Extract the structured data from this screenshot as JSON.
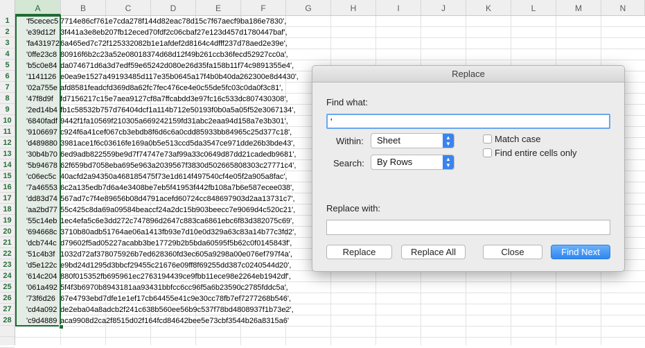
{
  "columns": [
    "A",
    "B",
    "C",
    "D",
    "E",
    "F",
    "G",
    "H",
    "I",
    "J",
    "K",
    "L",
    "M",
    "N"
  ],
  "rows": [
    {
      "n": "1",
      "a": "'f5cecec5",
      "rest": "7714e86cf761e7cda278f144d82eac78d15c7f67aecf9ba186e7830',"
    },
    {
      "n": "2",
      "a": "'e39d12f",
      "rest": "3f441a3e8eb207fb12eced70fdf2c06cbaf27e123d457d1780447baf',"
    },
    {
      "n": "3",
      "a": "'fa431972",
      "rest": "6a465ed7c72f125332082b1e1afdef2d8164c4dfff237d78aed2e39e',"
    },
    {
      "n": "4",
      "a": "'0ffe23c8",
      "rest": "80916f6b2c23a52e08018374d68d12f49b261ccb36fecd52927cc0a',"
    },
    {
      "n": "5",
      "a": "'b5c0e84",
      "rest": "da074671d6a3d7edf59e65242d080e26d35fa158b11f74c9891355e4',"
    },
    {
      "n": "6",
      "a": "'1141126",
      "rest": "e0ea9e1527a49193485d117e35b0645a17f4b0b40da262300e8d4430',"
    },
    {
      "n": "7",
      "a": "'02a755e",
      "rest": "afd8581feadcfd369d8a62fc7fec476ce4e0c55de5fc03c0da0f3c81',"
    },
    {
      "n": "8",
      "a": "'47f8d9f",
      "rest": "fd7156217c15e7aea9127cf8a7ffcabdd3e97fc16c533dc807430308',"
    },
    {
      "n": "9",
      "a": "'2ed14b4",
      "rest": "fb1c58532b757d76404dcf1a114b712e50193f0b0a5a05f52e3067134',"
    },
    {
      "n": "10",
      "a": "'6840fadf",
      "rest": "9442f1fa10569f210305a669242159fd31abc2eaa94d158a7e3b301',"
    },
    {
      "n": "11",
      "a": "'9106697",
      "rest": "c924f6a41cef067cb3ebdb8f6d6c6a0cdd85933bb84965c25d377c18',"
    },
    {
      "n": "12",
      "a": "'d489880",
      "rest": "3981ace1f6c03616fe169a0b5e513ccd5da3547ce971dde26b3bde43',"
    },
    {
      "n": "13",
      "a": "'30b4b70",
      "rest": "6ed9adb822559be9d7f74747e73af99a33c0649d87dd21cadedb9681',"
    },
    {
      "n": "14",
      "a": "'5b94678",
      "rest": "62f659bd7058eba695e963a2039567f3830d502665808303c27771c4',"
    },
    {
      "n": "15",
      "a": "'c06ec5c",
      "rest": "40acfd2a94350a468185475f73e1d614f497540cf4e05f2a905a8fac',"
    },
    {
      "n": "16",
      "a": "'7a46553",
      "rest": "6c2a135edb7d6a4e3408be7eb5f41953f442fb108a7b6e587ecee038',"
    },
    {
      "n": "17",
      "a": "'dd83d74",
      "rest": "567ad7c7f4e89656b08d4791acefd60724cc848697903d2aa13731c7',"
    },
    {
      "n": "18",
      "a": "'aa2bd77",
      "rest": "55c425c8da69a09584beaccf24a2dc15b903beecc7e9069d4c520c21',"
    },
    {
      "n": "19",
      "a": "'55c14eb",
      "rest": "1ec4efa5c6e3dd272c747896d2647c883ca6861ebc6f83d382075c69',"
    },
    {
      "n": "20",
      "a": "'694668c",
      "rest": "3710b80adb51764ae06a1413fb93e7d10e0d329a63c83a14b77c3fd2',"
    },
    {
      "n": "21",
      "a": "'dcb744c",
      "rest": "d79602f5ad05227acabb3be17729b2b5bda60595f5b62c0f0145843f',"
    },
    {
      "n": "22",
      "a": "'51c4b3f",
      "rest": "1032d72af378075926b7ed628360fd3ec605a9298a00e076ef797f4a',"
    },
    {
      "n": "23",
      "a": "'d5e122c",
      "rest": "e9bd24d1295d3bbcf29455c21676e09ff8f69255dd387c0240544d20',"
    },
    {
      "n": "24",
      "a": "'614c204",
      "rest": "880f015352fb695961ec2763194439ce9fbb11ece98e2264eb1942df',"
    },
    {
      "n": "25",
      "a": "'061a492",
      "rest": "5f4f3b6970b8943181aa93431bbfcc6cc96f5a6b23590c2785fddc5a',"
    },
    {
      "n": "26",
      "a": "'73f6d26",
      "rest": "67e4793ebd7dfe1e1ef17cb64455e41c9e30cc78fb7ef7277268b546',"
    },
    {
      "n": "27",
      "a": "'cd4a092",
      "rest": "de2eba04a8adcb2f241c638b560ee56b9c537f78bd4808937f1b73e2',"
    },
    {
      "n": "28",
      "a": "'c9d4889",
      "rest": "aca9908d2ca2f8515d02f164fcd84642bee5e73cbf3544b26a8315a6'"
    }
  ],
  "dialog": {
    "title": "Replace",
    "find_label": "Find what:",
    "find_value": "'",
    "within_label": "Within:",
    "within_value": "Sheet",
    "search_label": "Search:",
    "search_value": "By Rows",
    "match_case": "Match case",
    "entire_cells": "Find entire cells only",
    "replace_label": "Replace with:",
    "replace_value": "",
    "btn_replace": "Replace",
    "btn_replace_all": "Replace All",
    "btn_close": "Close",
    "btn_find_next": "Find Next"
  }
}
